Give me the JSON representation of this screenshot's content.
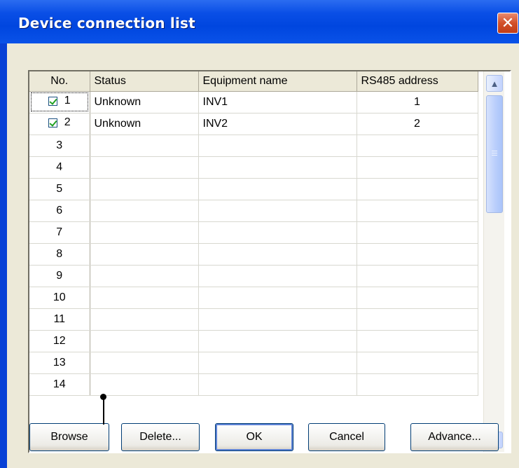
{
  "window": {
    "title": "Device connection list",
    "close_glyph": "✕"
  },
  "grid": {
    "columns": [
      "No.",
      "Status",
      "Equipment name",
      "RS485 address"
    ],
    "rows": [
      {
        "no": "1",
        "checked": true,
        "status": "Unknown",
        "name": "INV1",
        "address": "1"
      },
      {
        "no": "2",
        "checked": true,
        "status": "Unknown",
        "name": "INV2",
        "address": "2"
      },
      {
        "no": "3",
        "checked": false,
        "status": "",
        "name": "",
        "address": ""
      },
      {
        "no": "4",
        "checked": false,
        "status": "",
        "name": "",
        "address": ""
      },
      {
        "no": "5",
        "checked": false,
        "status": "",
        "name": "",
        "address": ""
      },
      {
        "no": "6",
        "checked": false,
        "status": "",
        "name": "",
        "address": ""
      },
      {
        "no": "7",
        "checked": false,
        "status": "",
        "name": "",
        "address": ""
      },
      {
        "no": "8",
        "checked": false,
        "status": "",
        "name": "",
        "address": ""
      },
      {
        "no": "9",
        "checked": false,
        "status": "",
        "name": "",
        "address": ""
      },
      {
        "no": "10",
        "checked": false,
        "status": "",
        "name": "",
        "address": ""
      },
      {
        "no": "11",
        "checked": false,
        "status": "",
        "name": "",
        "address": ""
      },
      {
        "no": "12",
        "checked": false,
        "status": "",
        "name": "",
        "address": ""
      },
      {
        "no": "13",
        "checked": false,
        "status": "",
        "name": "",
        "address": ""
      },
      {
        "no": "14",
        "checked": false,
        "status": "",
        "name": "",
        "address": ""
      }
    ],
    "scroll_up_icon": "▲",
    "scroll_down_icon": "▼"
  },
  "buttons": {
    "browse": "Browse",
    "delete": "Delete...",
    "ok": "OK",
    "cancel": "Cancel",
    "advance": "Advance..."
  },
  "colors": {
    "title_bar": "#0a4fe6",
    "dialog_face": "#ece9d8",
    "close_button": "#d2502a"
  }
}
